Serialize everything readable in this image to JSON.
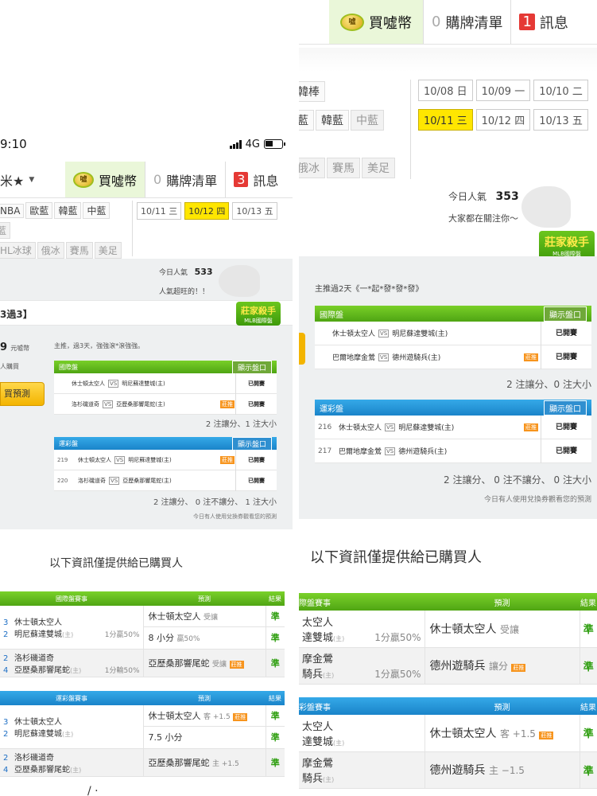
{
  "status": {
    "time": "9:10",
    "network": "4G"
  },
  "nav": {
    "left_title": "米★",
    "buy": "買噓幣",
    "cart": "購牌清單",
    "msg": "訊息",
    "cart_count_left": "0",
    "msg_count_left": "3",
    "cart_count_right": "0",
    "msg_count_right": "1"
  },
  "left": {
    "cats_row1": [
      "NBA",
      "歐藍",
      "韓藍",
      "中藍"
    ],
    "cats_row2": [
      "藍"
    ],
    "cats_row3": [
      "HL冰球",
      "俄冰",
      "賽馬",
      "美足"
    ],
    "dates": [
      "10/11 三",
      "10/12 四",
      "10/13 五"
    ],
    "pop_label": "今日人氣",
    "pop_value": "533",
    "pop_sub": "人氣超旺的！！",
    "banner_title": "3過3】",
    "logo_main": "莊家殺手",
    "logo_sub": "MLB國際盤",
    "coins_num": "9",
    "coins_unit": "元噓幣",
    "bought": "人購買",
    "buy_btn": "買預測",
    "recommend": "主推，過3天，強強滾*滾強強。",
    "intl_title": "國際盤",
    "lot_title": "運彩盤",
    "show_btn": "顯示盤口",
    "intl_rows": [
      {
        "away": "休士頓太空人",
        "home": "明尼蘇達雙城(主)",
        "status": "已開賽",
        "tag": ""
      },
      {
        "away": "洛杉磯道奇",
        "home": "亞歷桑那響尾蛇(主)",
        "status": "已開賽",
        "tag": "莊推"
      }
    ],
    "lot_rows": [
      {
        "num": "219",
        "away": "休士頓太空人",
        "home": "明尼蘇達雙城(主)",
        "status": "已開賽",
        "tag": "莊推"
      },
      {
        "num": "220",
        "away": "洛杉磯道奇",
        "home": "亞歷桑那響尾蛇(主)",
        "status": "已開賽",
        "tag": ""
      }
    ],
    "summary1": "2 注讓分、1 注大小",
    "summary2": "2 注讓分、 0 注不讓分、 1 注大小",
    "note": "今日有人使用兌換券觀看您的預測",
    "info_header": "以下資訊僅提供給已購買人",
    "table1_head": [
      "國際盤賽事",
      "預測",
      "結果"
    ],
    "table1": [
      {
        "n1": "3",
        "t1": "休士頓太空人",
        "n2": "2",
        "t2": "明尼蘇達雙城",
        "h": "(主)",
        "line": "1分贏50%",
        "p1": "休士頓太空人",
        "p1s": "受讓",
        "r1": "準",
        "p2": "8 小分",
        "p2s": "贏50%",
        "r2": "準"
      },
      {
        "n1": "2",
        "t1": "洛杉磯道奇",
        "n2": "4",
        "t2": "亞歷桑那響尾蛇",
        "h": "(主)",
        "line": "1分輸50%",
        "p1": "亞歷桑那響尾蛇",
        "p1s": "受讓",
        "tag": "莊推",
        "r1": "準"
      }
    ],
    "table2_head": [
      "運彩盤賽事",
      "預測",
      "結果"
    ],
    "table2": [
      {
        "n1": "3",
        "t1": "休士頓太空人",
        "n2": "2",
        "t2": "明尼蘇達雙城",
        "h": "(主)",
        "p1": "休士頓太空人",
        "p1s": "客 +1.5",
        "tag": "莊推",
        "r1": "準",
        "p2": "7.5 小分",
        "r2": "準"
      },
      {
        "n1": "2",
        "t1": "洛杉磯道奇",
        "n2": "4",
        "t2": "亞歷桑那響尾蛇",
        "h": "(主)",
        "p1": "亞歷桑那響尾蛇",
        "p1s": "主 +1.5",
        "r1": "準"
      }
    ],
    "bottom_partial": "/ ·"
  },
  "right": {
    "cats_row1": [
      "韓棒"
    ],
    "cats_row2": [
      "藍",
      "韓藍",
      "中藍"
    ],
    "cats_row3": [
      "俄冰",
      "賽馬",
      "美足"
    ],
    "dates_row1": [
      "10/08 日",
      "10/09 一",
      "10/10 二"
    ],
    "dates_row2": [
      "10/11 三",
      "10/12 四",
      "10/13 五"
    ],
    "pop_label": "今日人氣",
    "pop_value": "353",
    "pop_sub": "大家都在關注你～",
    "logo_main": "莊家殺手",
    "logo_sub": "MLB國際盤",
    "recommend": "主推過2天《一*起*發*發*發》",
    "intl_title": "國際盤",
    "lot_title": "運彩盤",
    "show_btn": "顯示盤口",
    "intl_rows": [
      {
        "away": "休士頓太空人",
        "home": "明尼蘇達雙城(主)",
        "status": "已開賽",
        "tag": ""
      },
      {
        "away": "巴爾地摩金鶯",
        "home": "德州遊騎兵(主)",
        "status": "已開賽",
        "tag": "莊推"
      }
    ],
    "lot_rows": [
      {
        "num": "216",
        "away": "休士頓太空人",
        "home": "明尼蘇達雙城(主)",
        "status": "已開賽",
        "tag": "莊推"
      },
      {
        "num": "217",
        "away": "巴爾地摩金鶯",
        "home": "德州遊騎兵(主)",
        "status": "已開賽",
        "tag": ""
      }
    ],
    "summary1": "2 注讓分、0 注大小",
    "summary2": "2 注讓分、 0 注不讓分、 0 注大小",
    "note": "今日有人使用兌換券觀看您的預測",
    "info_header": "以下資訊僅提供給已購買人",
    "table1_head": [
      "際盤賽事",
      "預測",
      "結果"
    ],
    "table1": [
      {
        "t1": "太空人",
        "t2": "達雙城",
        "h": "(主)",
        "line": "1分贏50%",
        "p1": "休士頓太空人",
        "p1s": "受讓",
        "r1": "準"
      },
      {
        "t1": "摩金鶯",
        "t2": "騎兵",
        "h": "(主)",
        "line": "1分贏50%",
        "p1": "德州遊騎兵",
        "p1s": "讓分",
        "tag": "莊推",
        "r1": "準"
      }
    ],
    "table2_head": [
      "彩盤賽事",
      "預測",
      "結果"
    ],
    "table2": [
      {
        "t1": "太空人",
        "t2": "達雙城",
        "h": "(主)",
        "p1": "休士頓太空人",
        "p1s": "客 +1.5",
        "tag": "莊推",
        "r1": "準"
      },
      {
        "t1": "摩金鶯",
        "t2": "騎兵",
        "h": "(主)",
        "p1": "德州遊騎兵",
        "p1s": "主 −1.5",
        "r1": "準"
      }
    ]
  }
}
